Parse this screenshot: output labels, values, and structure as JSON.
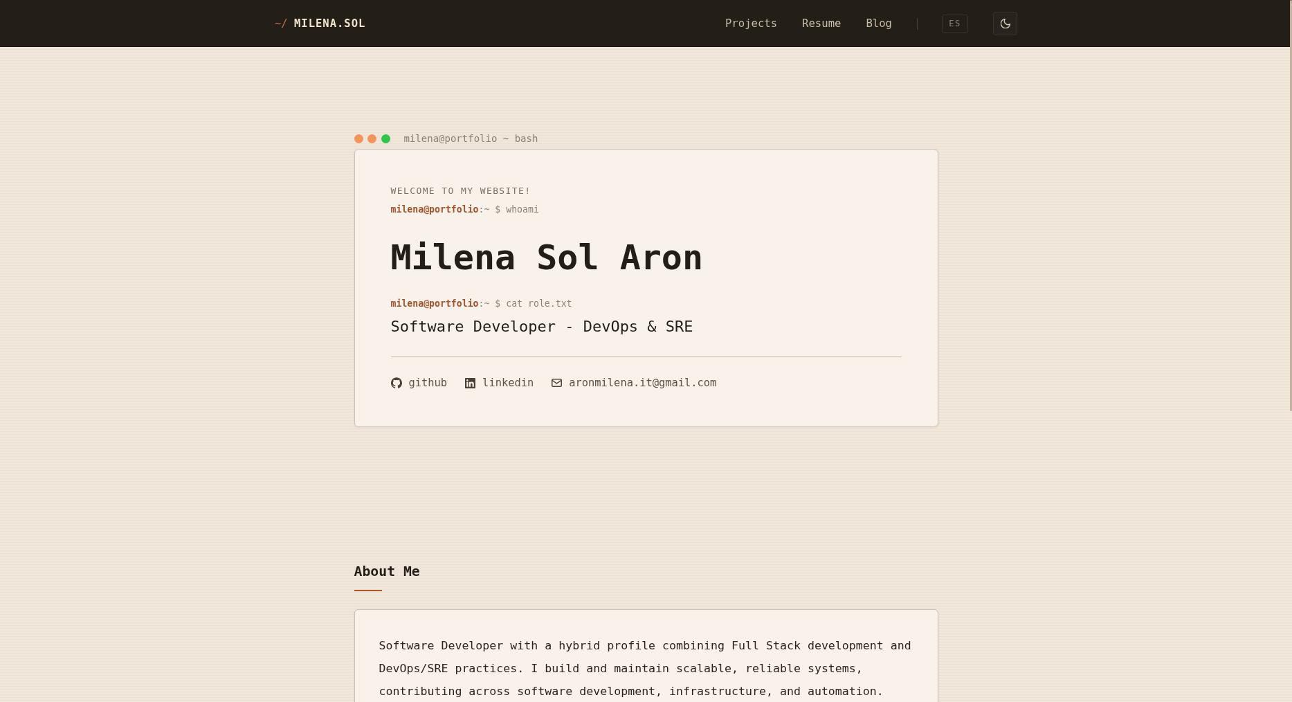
{
  "header": {
    "logo": {
      "prefix": "~/",
      "name": "MILENA.SOL"
    },
    "nav": [
      "Projects",
      "Resume",
      "Blog"
    ],
    "language_button": "ES"
  },
  "terminal": {
    "dots": [
      {
        "color": "#f4945b"
      },
      {
        "color": "#f4945b"
      },
      {
        "color": "#2fc74a"
      }
    ],
    "title": "milena@portfolio ~ bash",
    "greeting": "WELCOME TO MY WEBSITE!",
    "prompt_1": "**milena@portfolio**:~ $ whoami",
    "name": "Milena Sol Aron",
    "prompt_2": "**milena@portfolio**:~ $ cat role.txt",
    "role": "Software Developer - DevOps & SRE",
    "links": [
      {
        "kind": "github",
        "label": "github"
      },
      {
        "kind": "linkedin",
        "label": "linkedin"
      },
      {
        "kind": "email",
        "label": "aronmilena.it@gmail.com"
      }
    ]
  },
  "about": {
    "heading": "About Me",
    "text": "Software Developer with a hybrid profile combining Full Stack development and DevOps/SRE practices. I build and maintain scalable, reliable systems, contributing across software development, infrastructure, and automation."
  }
}
